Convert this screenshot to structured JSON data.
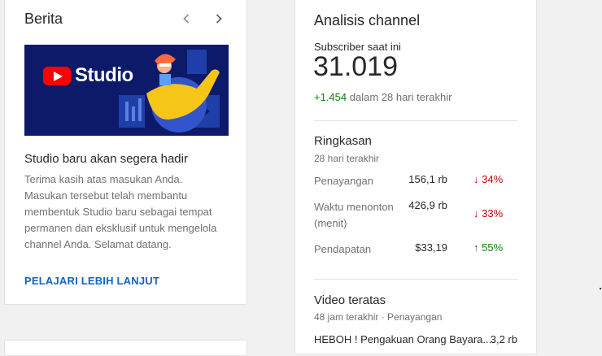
{
  "news": {
    "title": "Berita",
    "prev_icon": "chevron-left-icon",
    "next_icon": "chevron-right-icon",
    "banner_word": "Studio",
    "article_title": "Studio baru akan segera hadir",
    "article_body": "Terima kasih atas masukan Anda. Masukan tersebut telah membantu membentuk Studio baru sebagai tempat permanen dan eksklusif untuk mengelola channel Anda. Selamat datang.",
    "link": "PELAJARI LEBIH LANJUT"
  },
  "analytics": {
    "title": "Analisis channel",
    "subscribers_label": "Subscriber saat ini",
    "subscribers_value": "31.019",
    "subscribers_delta": "+1.454",
    "subscribers_delta_suffix": "dalam 28 hari terakhir",
    "summary": {
      "title": "Ringkasan",
      "period": "28 hari terakhir",
      "rows": [
        {
          "label": "Penayangan",
          "value": "156,1 rb",
          "change": "34%",
          "direction": "down"
        },
        {
          "label": "Waktu menonton (menit)",
          "value": "426,9 rb",
          "change": "33%",
          "direction": "down"
        },
        {
          "label": "Pendapatan",
          "value": "$33,19",
          "change": "55%",
          "direction": "up"
        }
      ]
    },
    "top_videos": {
      "title": "Video teratas",
      "period": "48 jam terakhir · Penayangan",
      "items": [
        {
          "title": "HEBOH ! Pengakuan Orang Bayara...",
          "views": "3,2 rb"
        }
      ]
    }
  },
  "colors": {
    "accent_link": "#1565c0",
    "negative": "#cc0000",
    "positive": "#138013",
    "banner_bg": "#0d1a6a"
  }
}
